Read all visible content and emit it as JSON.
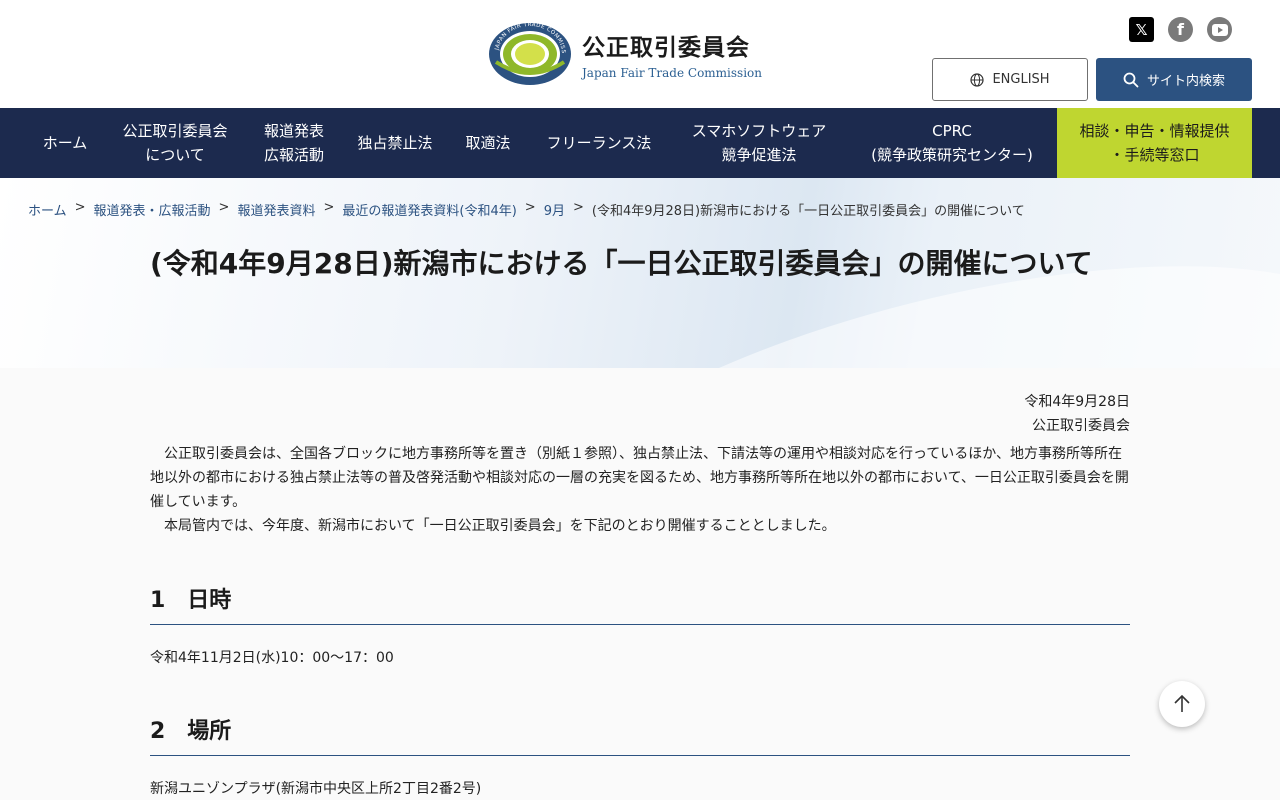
{
  "header": {
    "title_jp": "公正取引委員会",
    "title_en": "Japan Fair Trade Commission",
    "logo_ring_text": "JAPAN FAIR TRADE COMMISSION",
    "lang_label": "ENGLISH",
    "search_label": "サイト内検索",
    "social": [
      {
        "name": "x-icon",
        "glyph": "𝕏"
      },
      {
        "name": "facebook-icon",
        "glyph": "f"
      },
      {
        "name": "youtube-icon"
      }
    ]
  },
  "nav": {
    "items": [
      {
        "label": "ホーム"
      },
      {
        "label": "公正取引委員会\nについて"
      },
      {
        "label": "報道発表\n広報活動"
      },
      {
        "label": "独占禁止法"
      },
      {
        "label": "取適法"
      },
      {
        "label": "フリーランス法"
      },
      {
        "label": "スマホソフトウェア\n競争促進法"
      },
      {
        "label": "CPRC\n(競争政策研究センター)"
      },
      {
        "label": "相談・申告・情報提供\n・手続等窓口"
      }
    ]
  },
  "breadcrumb": {
    "links": [
      "ホーム",
      "報道発表・広報活動",
      "報道発表資料",
      "最近の報道発表資料(令和4年)",
      "9月"
    ],
    "current": "(令和4年9月28日)新潟市における「一日公正取引委員会」の開催について",
    "separator": ">"
  },
  "page": {
    "title": "(令和4年9月28日)新潟市における「一日公正取引委員会」の開催について",
    "date": "令和4年9月28日",
    "issuer": "公正取引委員会",
    "paragraph1": "公正取引委員会は、全国各ブロックに地方事務所等を置き（別紙１参照）、独占禁止法、下請法等の運用や相談対応を行っているほか、地方事務所等所在地以外の都市における独占禁止法等の普及啓発活動や相談対応の一層の充実を図るため、地方事務所等所在地以外の都市において、一日公正取引委員会を開催しています。",
    "paragraph2": "本局管内では、今年度、新潟市において「一日公正取引委員会」を下記のとおり開催することとしました。",
    "sections": [
      {
        "heading": "1　日時",
        "text": "令和4年11月2日(水)10：00～17：00"
      },
      {
        "heading": "2　場所",
        "text": "新潟ユニゾンプラザ(新潟市中央区上所2丁目2番2号)"
      }
    ]
  },
  "colors": {
    "nav_bg": "#1c2a4e",
    "accent_blue": "#2c5281",
    "consult_bg": "#bfd630"
  }
}
